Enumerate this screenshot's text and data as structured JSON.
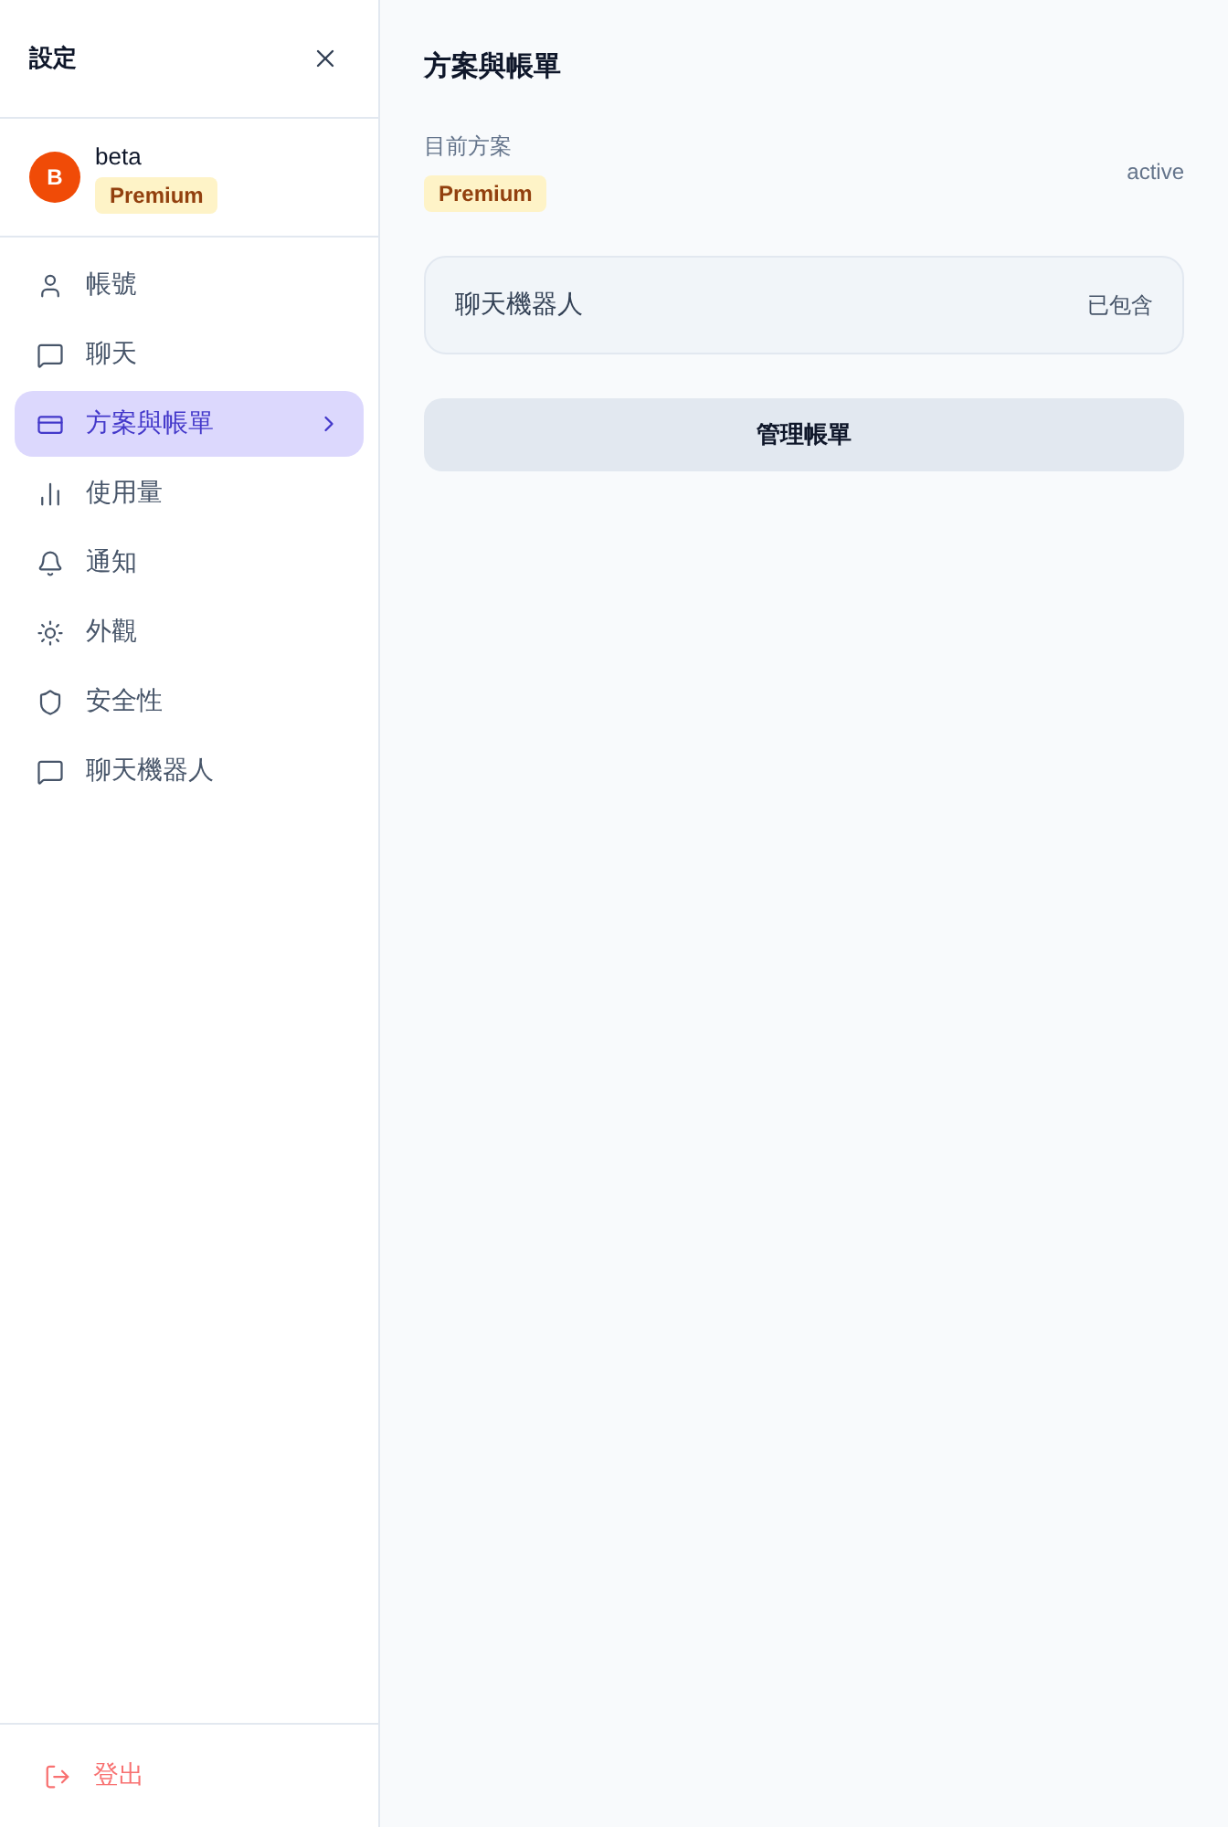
{
  "sidebar": {
    "title": "設定",
    "profile": {
      "avatar_initial": "B",
      "name": "beta",
      "plan_badge": "Premium"
    },
    "items": [
      {
        "label": "帳號",
        "kind": "user",
        "selected": false
      },
      {
        "label": "聊天",
        "kind": "chat",
        "selected": false
      },
      {
        "label": "方案與帳單",
        "kind": "card",
        "selected": true
      },
      {
        "label": "使用量",
        "kind": "chart",
        "selected": false
      },
      {
        "label": "通知",
        "kind": "bell",
        "selected": false
      },
      {
        "label": "外觀",
        "kind": "sun",
        "selected": false
      },
      {
        "label": "安全性",
        "kind": "shield",
        "selected": false
      },
      {
        "label": "聊天機器人",
        "kind": "chat",
        "selected": false
      }
    ],
    "logout": "登出"
  },
  "main": {
    "title": "方案與帳單",
    "current_plan": {
      "label": "目前方案",
      "badge": "Premium",
      "status": "active"
    },
    "features": [
      {
        "name": "聊天機器人",
        "status": "已包含"
      }
    ],
    "manage_button": "管理帳單"
  }
}
